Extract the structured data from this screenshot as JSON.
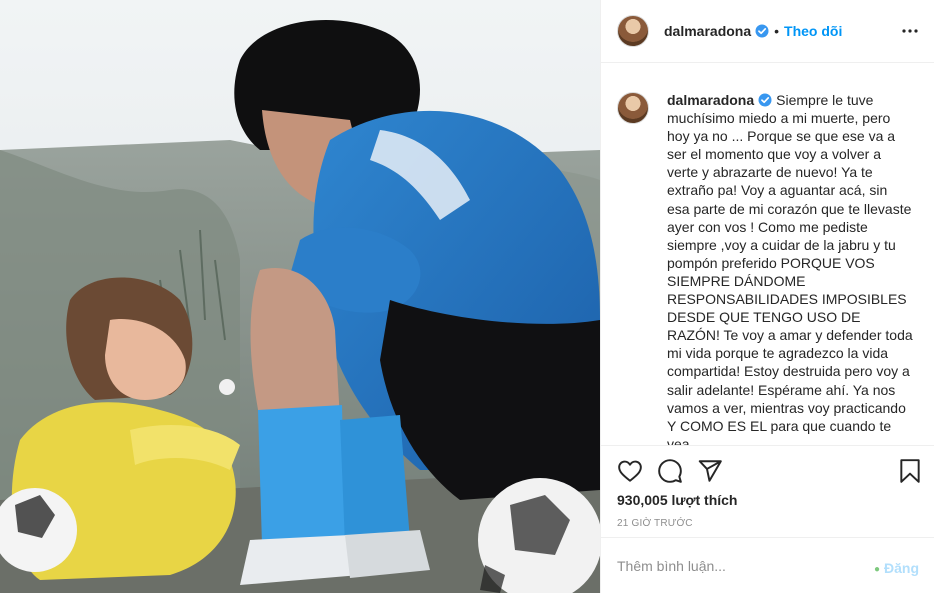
{
  "post": {
    "image_alt": "photo",
    "author": "dalmaradona",
    "follow_label": "Theo dõi",
    "dot": "•",
    "caption": "Siempre le tuve muchísimo miedo a mi muerte, pero hoy ya no ... Porque se que ese va a ser el momento que voy a volver a verte y abrazarte de nuevo! Ya te extraño pa! Voy a aguantar acá, sin esa parte de mi corazón que te llevaste ayer con vos ! Como me pediste siempre ,voy a cuidar de la jabru y tu pompón preferido PORQUE VOS SIEMPRE DÁNDOME RESPONSABILIDADES IMPOSIBLES DESDE QUE TENGO USO DE RAZÓN! Te voy a amar y defender toda mi vida porque te agradezco la vida compartida! Estoy destruida pero voy a salir adelante! Espérame ahí. Ya nos vamos a ver, mientras voy practicando Y COMO ES EL para que cuando te vea",
    "likes": "930,005 lượt thích",
    "time": "21 GIỜ TRƯỚC"
  },
  "comment": {
    "placeholder": "Thêm bình luận...",
    "post_label": "Đăng"
  },
  "colors": {
    "accent": "#0095f6",
    "verified": "#3897f0",
    "post_disabled": "#b2dffc"
  },
  "icons": {
    "like": "heart-icon",
    "comment": "comment-icon",
    "share": "paper-plane-icon",
    "save": "bookmark-icon",
    "more": "more-icon",
    "verified": "verified-badge-icon"
  }
}
